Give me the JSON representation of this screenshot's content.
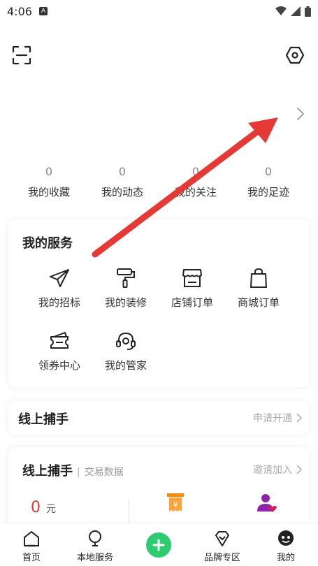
{
  "status_bar": {
    "time": "4:06",
    "notification_badge": "A"
  },
  "stats": [
    {
      "value": "0",
      "label": "我的收藏"
    },
    {
      "value": "0",
      "label": "我的动态"
    },
    {
      "value": "0",
      "label": "我的关注"
    },
    {
      "value": "0",
      "label": "我的足迹"
    }
  ],
  "services": {
    "title": "我的服务",
    "items": [
      {
        "label": "我的招标",
        "icon": "paper-plane-icon"
      },
      {
        "label": "我的装修",
        "icon": "paint-roller-icon"
      },
      {
        "label": "店铺订单",
        "icon": "storefront-icon"
      },
      {
        "label": "商城订单",
        "icon": "shopping-bag-icon"
      },
      {
        "label": "领券中心",
        "icon": "coupon-icon"
      },
      {
        "label": "我的管家",
        "icon": "headset-icon"
      }
    ]
  },
  "online_helper": {
    "title": "线上捕手",
    "action": "申请开通"
  },
  "trade_stats": {
    "title": "线上捕手",
    "separator": "|",
    "subtitle": "交易数据",
    "action": "邀请加入",
    "amount": "0",
    "unit": "元"
  },
  "bottom_nav": {
    "home": "首页",
    "local": "本地服务",
    "brand": "品牌专区",
    "mine": "我的"
  },
  "colors": {
    "accent_green": "#2ecc71",
    "amount_red": "#e53935",
    "arrow_red": "#e53935"
  }
}
